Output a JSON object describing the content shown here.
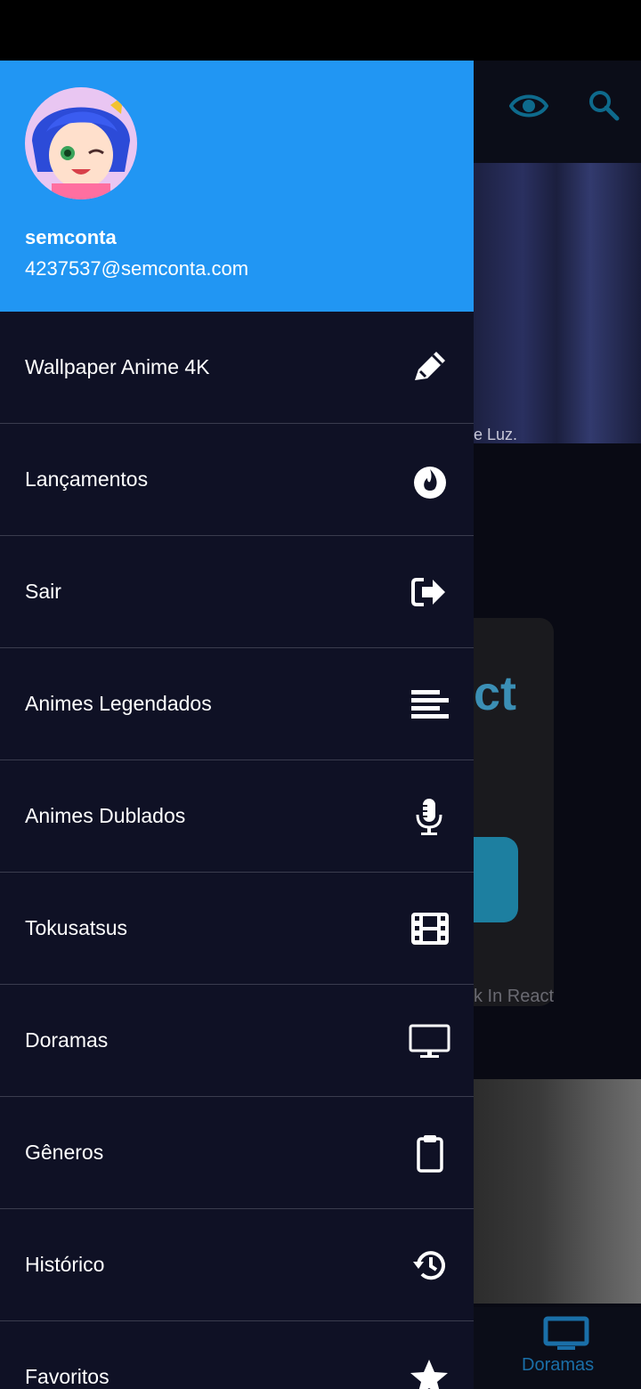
{
  "drawer": {
    "user": {
      "name": "semconta",
      "email": "4237537@semconta.com"
    },
    "items": [
      {
        "label": "Wallpaper Anime 4K",
        "icon": "pencil-icon"
      },
      {
        "label": "Lançamentos",
        "icon": "fire-icon"
      },
      {
        "label": "Sair",
        "icon": "sign-out-icon"
      },
      {
        "label": "Animes Legendados",
        "icon": "align-left-icon"
      },
      {
        "label": "Animes Dublados",
        "icon": "microphone-icon"
      },
      {
        "label": "Tokusatsus",
        "icon": "film-icon"
      },
      {
        "label": "Doramas",
        "icon": "tv-icon"
      },
      {
        "label": "Gêneros",
        "icon": "clipboard-icon"
      },
      {
        "label": "Histórico",
        "icon": "history-icon"
      },
      {
        "label": "Favoritos",
        "icon": "star-icon"
      }
    ]
  },
  "background": {
    "thumb_caption": "e Luz.",
    "card_text": "ct",
    "card_caption": "k In React",
    "bottom_nav_label": "Doramas"
  },
  "colors": {
    "header": "#2196f3",
    "drawer_bg": "#0f1125",
    "divider": "#3a3c4e",
    "accent_dim": "#1a6fa8"
  }
}
